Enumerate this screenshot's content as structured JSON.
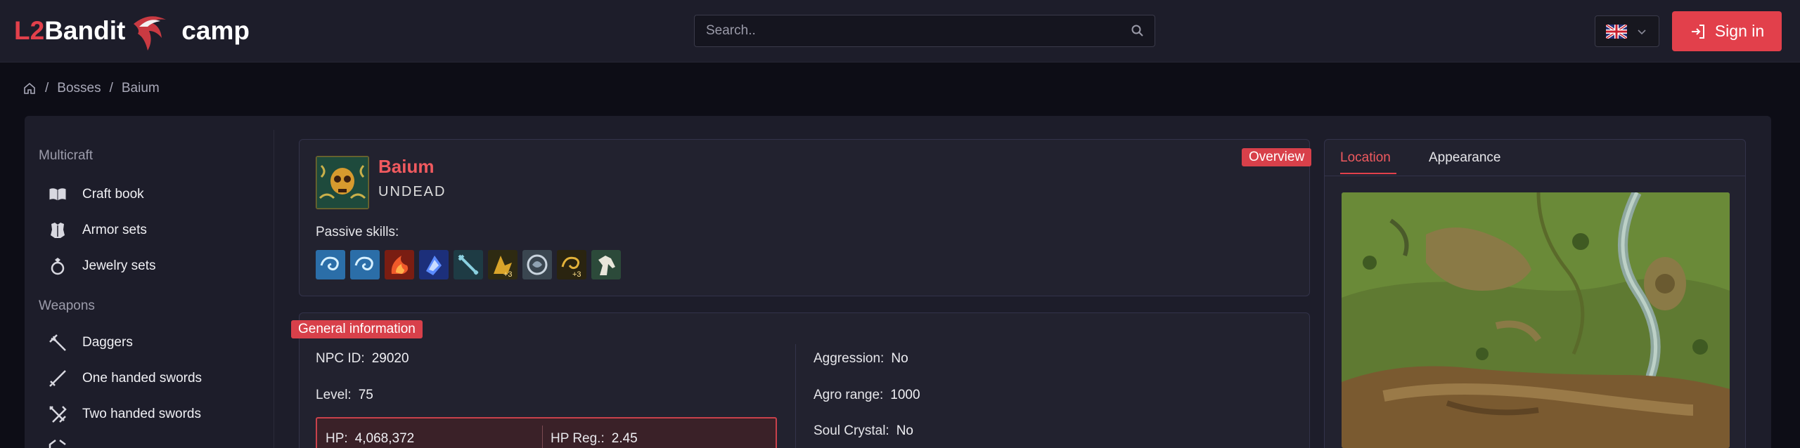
{
  "header": {
    "logo": {
      "part1": "L2",
      "part2": "Bandit",
      "part3": "camp"
    },
    "search_placeholder": "Search..",
    "sign_in_label": "Sign in",
    "language": "English"
  },
  "breadcrumb": {
    "items": [
      "Bosses",
      "Baium"
    ]
  },
  "sidebar": {
    "sections": [
      {
        "heading": "Multicraft",
        "items": [
          "Craft book",
          "Armor sets",
          "Jewelry sets"
        ]
      },
      {
        "heading": "Weapons",
        "items": [
          "Daggers",
          "One handed swords",
          "Two handed swords"
        ]
      }
    ]
  },
  "overview": {
    "ribbon": "Overview",
    "boss_name": "Baium",
    "race": "UNDEAD",
    "passive_label": "Passive skills:"
  },
  "general": {
    "ribbon": "General information",
    "npc_id_label": "NPC ID:",
    "npc_id": "29020",
    "level_label": "Level:",
    "level": "75",
    "hp_label": "HP:",
    "hp": "4,068,372",
    "hp_reg_label": "HP Reg.:",
    "hp_reg": "2.45",
    "aggression_label": "Aggression:",
    "aggression": "No",
    "agro_range_label": "Agro range:",
    "agro_range": "1000",
    "soul_crystal_label": "Soul Crystal:",
    "soul_crystal": "No"
  },
  "tabs": {
    "location": "Location",
    "appearance": "Appearance",
    "active": "Location"
  },
  "colors": {
    "accent": "#e2404b",
    "panel": "#1d1d2a",
    "background": "#0d0d16"
  }
}
